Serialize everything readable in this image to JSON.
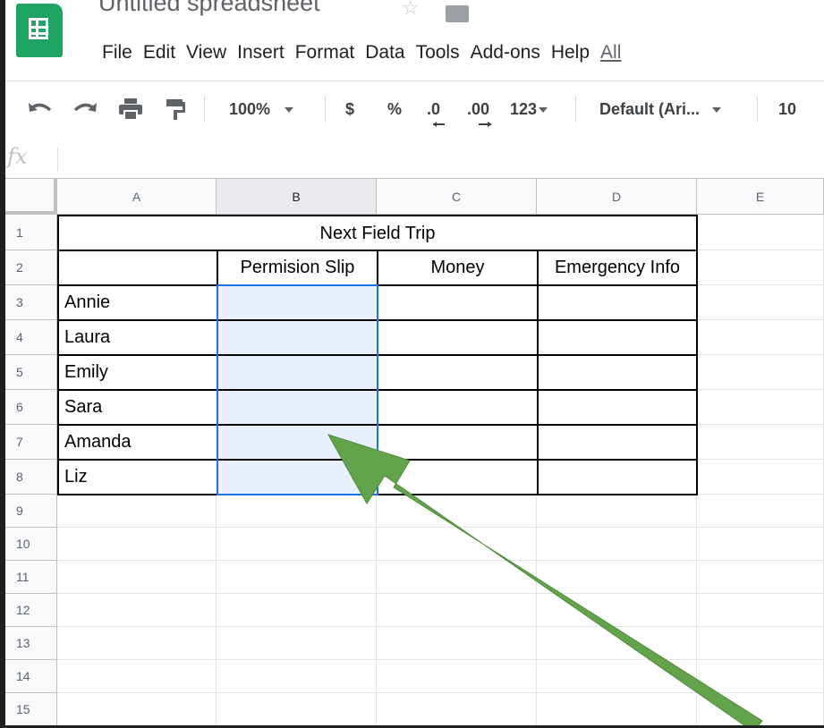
{
  "doc": {
    "title": "Untitled spreadsheet"
  },
  "menu": [
    "File",
    "Edit",
    "View",
    "Insert",
    "Format",
    "Data",
    "Tools",
    "Add-ons",
    "Help",
    "All"
  ],
  "toolbar": {
    "zoom": "100%",
    "currency": "$",
    "percent": "%",
    "dec_less": ".0",
    "dec_more": ".00",
    "more_formats": "123",
    "font": "Default (Ari...",
    "font_size": "10"
  },
  "formula_bar": {
    "fx": "fx",
    "value": ""
  },
  "columns": [
    "A",
    "B",
    "C",
    "D",
    "E"
  ],
  "rows": [
    "1",
    "2",
    "3",
    "4",
    "5",
    "6",
    "7",
    "8",
    "9",
    "10",
    "11",
    "12",
    "13",
    "14",
    "15"
  ],
  "sheet": {
    "title": "Next Field Trip",
    "headers": [
      "Permision Slip",
      "Money",
      "Emergency Info"
    ],
    "names": [
      "Annie",
      "Laura",
      "Emily",
      "Sara",
      "Amanda",
      "Liz"
    ]
  },
  "colors": {
    "brand_green": "#1fa463",
    "selection": "#1a73e8",
    "arrow": "#63a34b"
  }
}
